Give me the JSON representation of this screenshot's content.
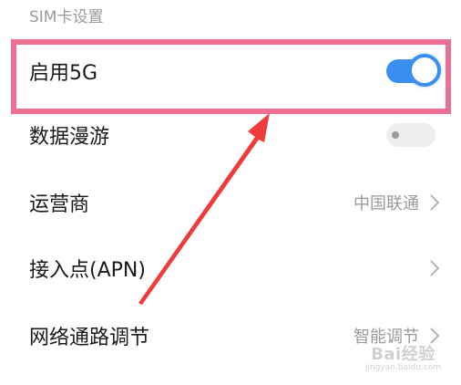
{
  "section": {
    "title": "SIM卡设置"
  },
  "rows": [
    {
      "label": "启用5G",
      "control": "toggle",
      "state": "on"
    },
    {
      "label": "数据漫游",
      "control": "toggle",
      "state": "off"
    },
    {
      "label": "运营商",
      "control": "chevron",
      "value": "中国联通"
    },
    {
      "label": "接入点(APN)",
      "control": "chevron",
      "value": ""
    },
    {
      "label": "网络通路调节",
      "control": "chevron",
      "value": "智能调节"
    }
  ],
  "watermark": {
    "main": "Bai经验",
    "sub": "jingyan.baidu.com"
  },
  "colors": {
    "toggle_on": "#3b8ff0",
    "toggle_off": "#eeeeee",
    "highlight": "#ee6f93",
    "arrow": "#ef3b3b"
  }
}
